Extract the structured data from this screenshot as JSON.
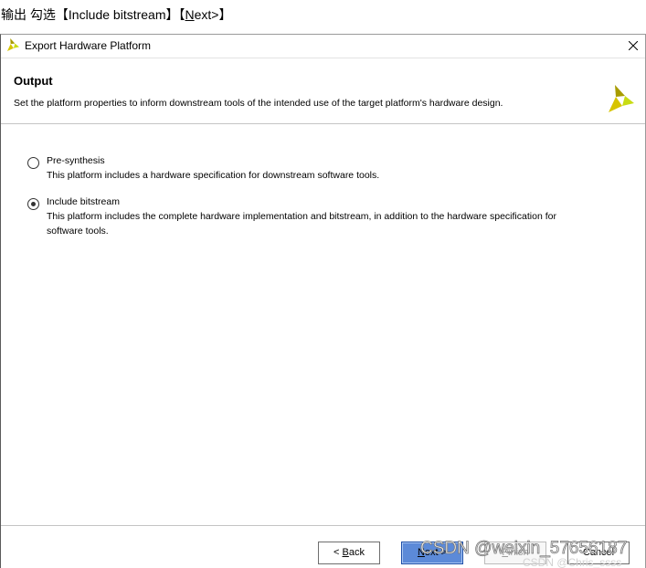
{
  "caption": {
    "prefix": "输出 勾选【Include bitstream】【",
    "mnemonic": "N",
    "suffix": "ext>】"
  },
  "dialog": {
    "title": "Export Hardware Platform",
    "icons": {
      "app": "vivado-logo-icon",
      "close": "close-icon",
      "header_logo": "vivado-logo-icon"
    },
    "header": {
      "title": "Output",
      "subtitle": "Set the platform properties to inform downstream tools of the intended use of the target platform's hardware design."
    },
    "options": [
      {
        "label": "Pre-synthesis",
        "description": [
          "This platform includes a hardware specification for downstream software tools."
        ],
        "selected": false
      },
      {
        "label": "Include bitstream",
        "description": [
          "This platform includes the complete hardware implementation and bitstream, in addition to the hardware specification for",
          "software tools."
        ],
        "selected": true
      }
    ],
    "buttons": {
      "back": {
        "pre": "< ",
        "key": "B",
        "post": "ack",
        "enabled": true,
        "focused": false
      },
      "next": {
        "pre": "",
        "key": "N",
        "post": "ext >",
        "enabled": true,
        "focused": true
      },
      "finish": {
        "pre": "",
        "key": "F",
        "post": "inish",
        "enabled": false,
        "focused": false
      },
      "cancel": {
        "pre": "",
        "key": "",
        "post": "Cancel",
        "enabled": true,
        "focused": false
      }
    }
  },
  "watermark": {
    "primary": "CSDN @weixin_57656187",
    "secondary": "CSDN @Chris_ssss"
  },
  "colors": {
    "primary_button": "#5c8ad8",
    "logo_olive": "#a89c00",
    "logo_green": "#c8dc14",
    "logo_yellow": "#d7c400"
  }
}
